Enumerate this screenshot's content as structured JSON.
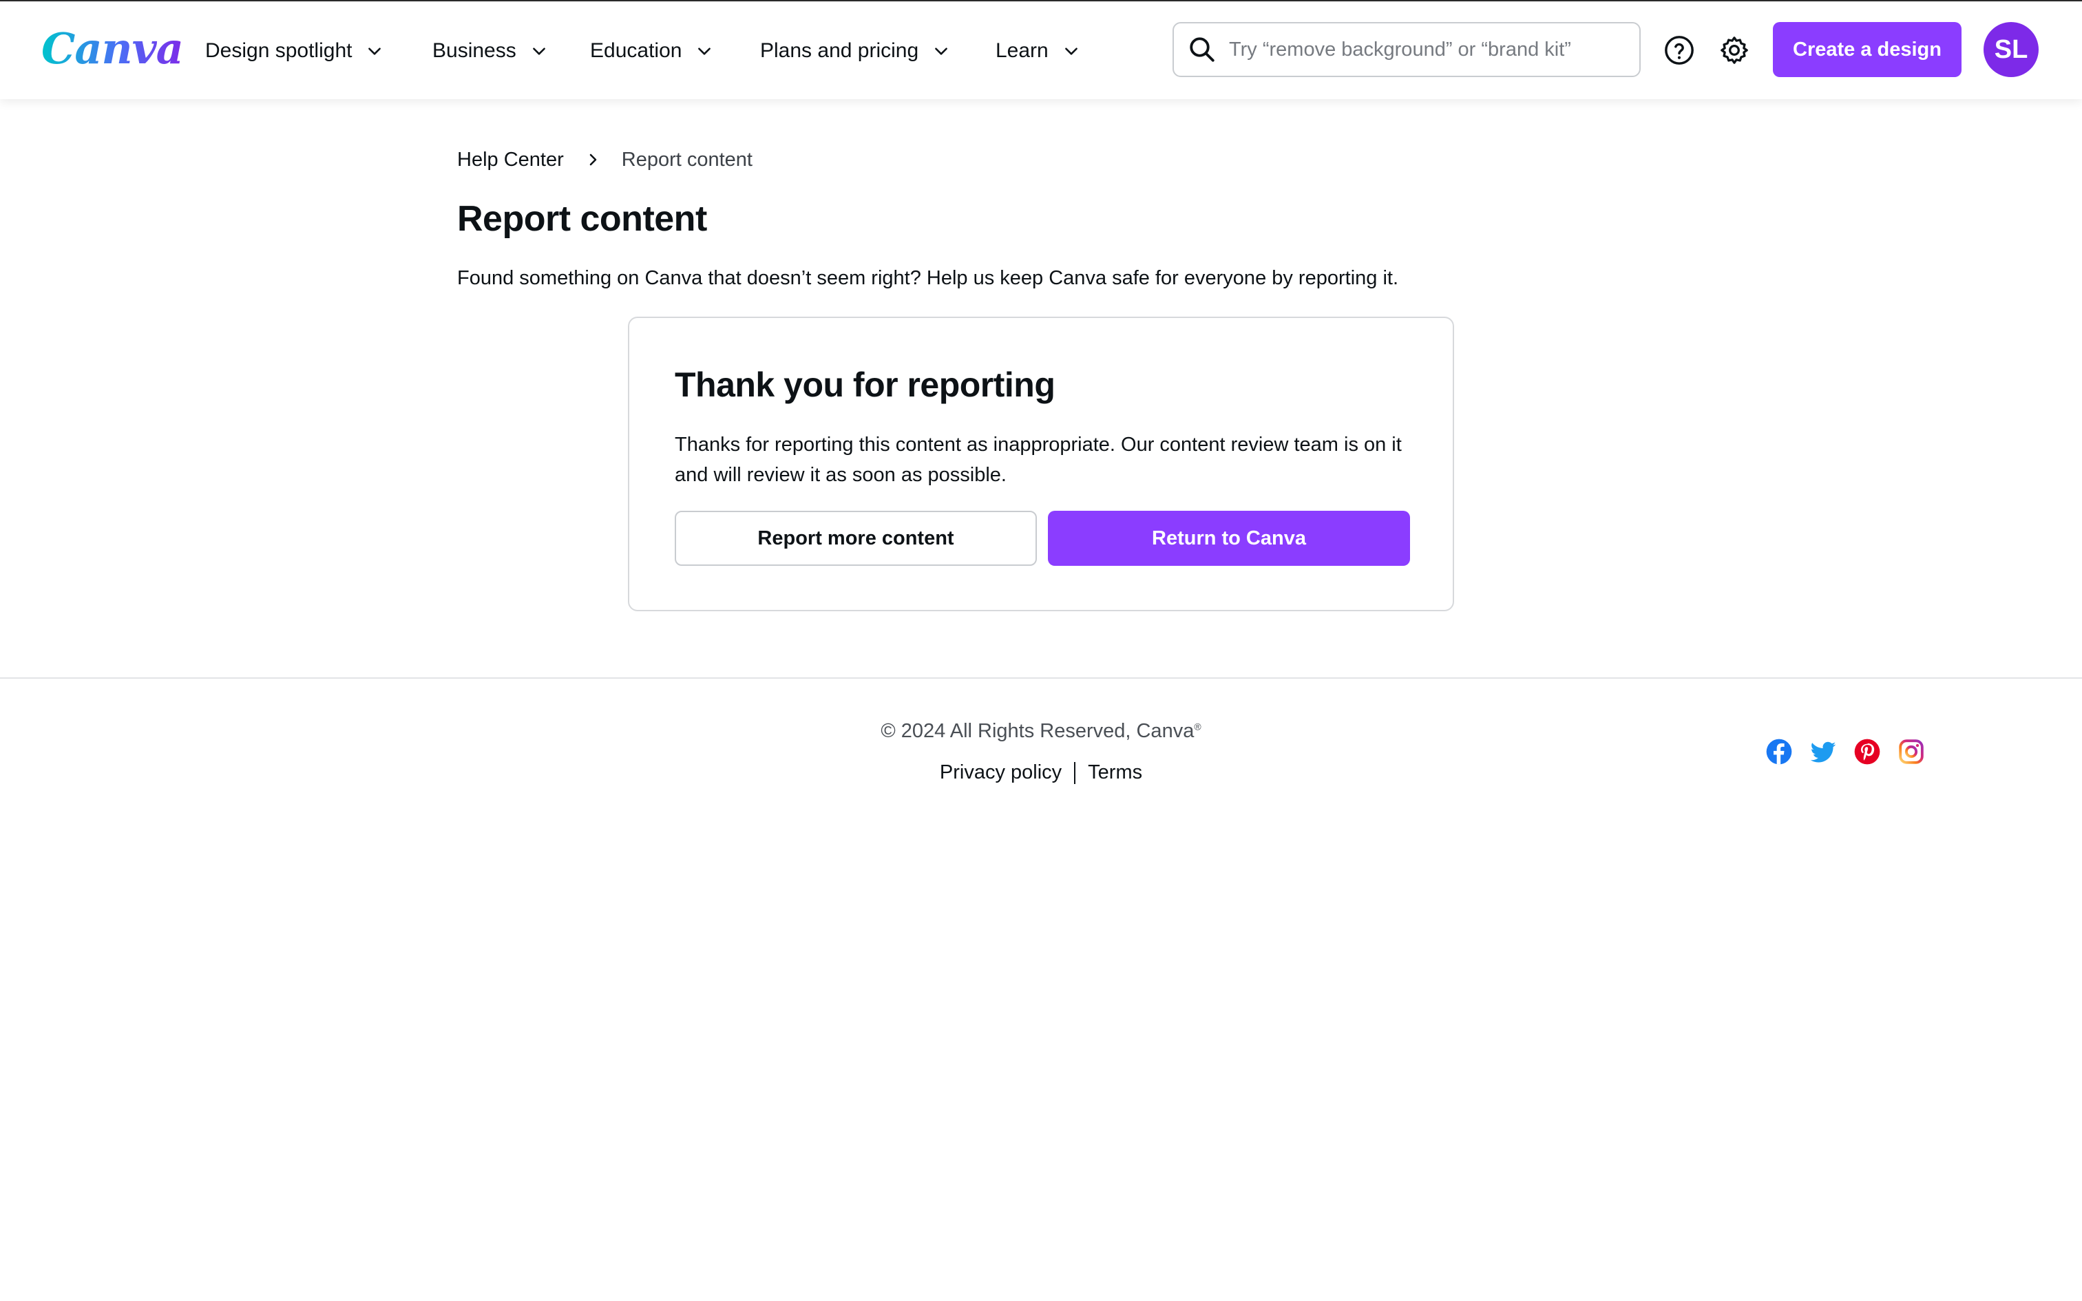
{
  "header": {
    "logo_text": "Canva",
    "nav": [
      {
        "label": "Design spotlight"
      },
      {
        "label": "Business"
      },
      {
        "label": "Education"
      },
      {
        "label": "Plans and pricing"
      },
      {
        "label": "Learn"
      }
    ],
    "search": {
      "placeholder": "Try “remove background” or “brand kit”",
      "value": ""
    },
    "help_icon": "help-circle-icon",
    "settings_icon": "gear-icon",
    "create_button_label": "Create a design",
    "avatar_initials": "SL"
  },
  "breadcrumb": {
    "home": "Help Center",
    "current": "Report content"
  },
  "page": {
    "title": "Report content",
    "intro": "Found something on Canva that doesn’t seem right? Help us keep Canva safe for everyone by reporting it."
  },
  "card": {
    "title": "Thank you for reporting",
    "text": "Thanks for reporting this content as inappropriate. Our content review team is on it and will review it as soon as possible.",
    "secondary_button": "Report more content",
    "primary_button": "Return to Canva"
  },
  "footer": {
    "copyright": "© 2024 All Rights Reserved, Canva",
    "trademark": "®",
    "links": [
      "Privacy policy",
      "Terms"
    ],
    "social": [
      "facebook-icon",
      "twitter-icon",
      "pinterest-icon",
      "instagram-icon"
    ]
  },
  "colors": {
    "brand_purple": "#8b3dff",
    "avatar_purple": "#7d2ae8",
    "facebook_blue": "#1877f2",
    "twitter_blue": "#1d9bf0",
    "pinterest_red": "#e60023"
  }
}
